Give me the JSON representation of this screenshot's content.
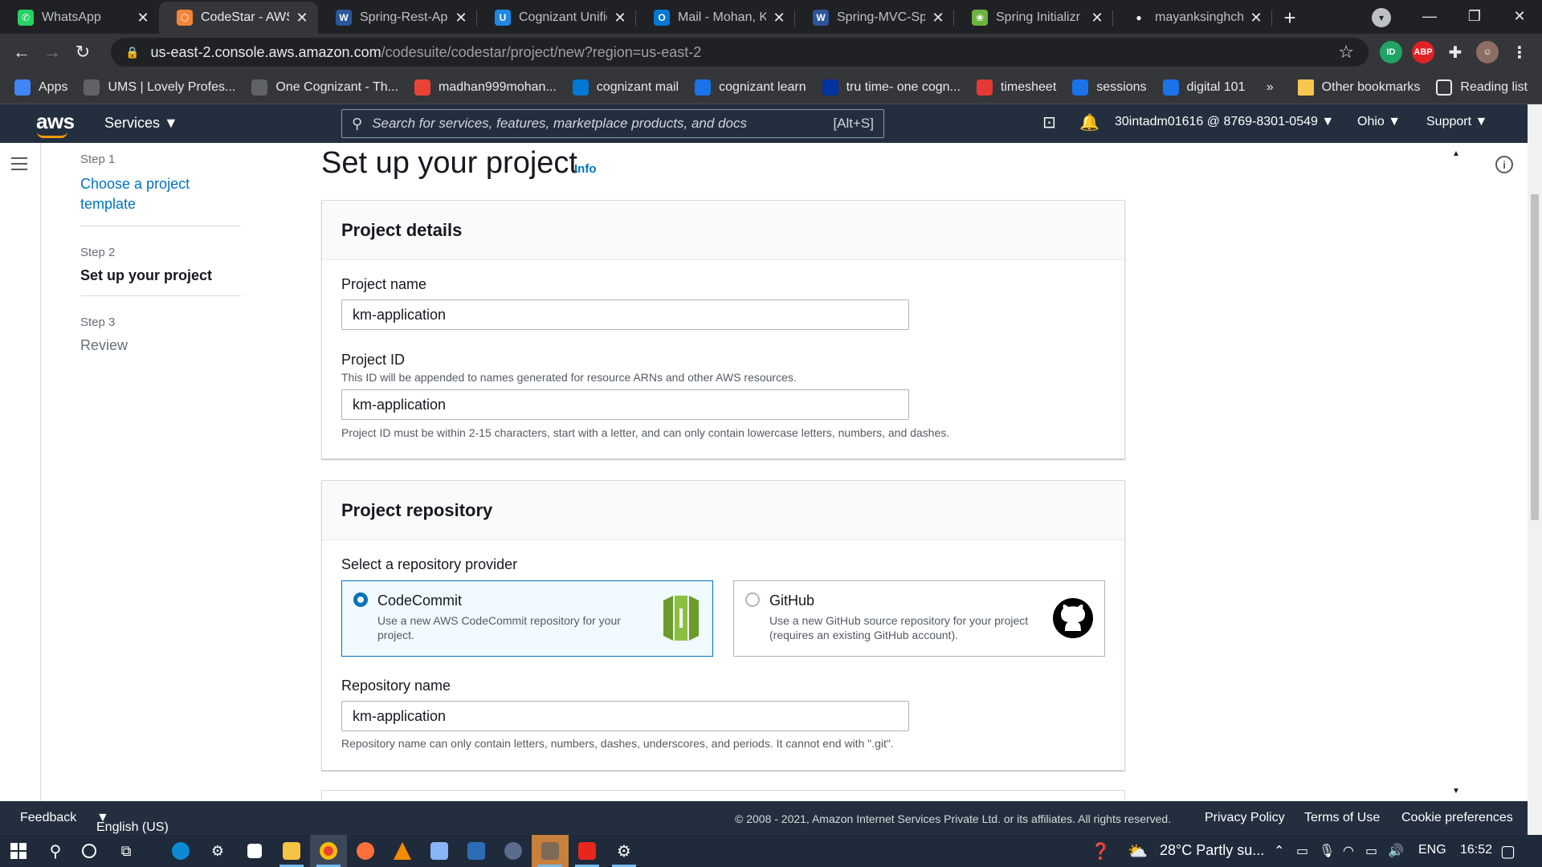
{
  "browser": {
    "tabs": [
      {
        "title": "WhatsApp",
        "color": "#25d366",
        "glyph": "✆"
      },
      {
        "title": "CodeStar - AWS D",
        "color": "#f58536",
        "glyph": "⬡"
      },
      {
        "title": "Spring-Rest-App",
        "color": "#2b579a",
        "glyph": "W"
      },
      {
        "title": "Cognizant Unified",
        "color": "#1e88e5",
        "glyph": "U"
      },
      {
        "title": "Mail - Mohan, Ko",
        "color": "#0078d4",
        "glyph": "O"
      },
      {
        "title": "Spring-MVC-Sprin",
        "color": "#2b579a",
        "glyph": "W"
      },
      {
        "title": "Spring Initializr",
        "color": "#6db33f",
        "glyph": "❀"
      },
      {
        "title": "mayanksinghchou",
        "color": "#202124",
        "glyph": "●"
      }
    ],
    "new_tab": "+",
    "url_host": "us-east-2.console.aws.amazon.com",
    "url_path": "/codesuite/codestar/project/new?region=us-east-2",
    "bookmarks": [
      {
        "label": "Apps",
        "color": "#4285f4"
      },
      {
        "label": "UMS | Lovely Profes...",
        "color": "#5f6368"
      },
      {
        "label": "One Cognizant - Th...",
        "color": "#5f6368"
      },
      {
        "label": "madhan999mohan...",
        "color": "#ea4335"
      },
      {
        "label": "cognizant mail",
        "color": "#0078d4"
      },
      {
        "label": "cognizant learn",
        "color": "#1a73e8"
      },
      {
        "label": "tru time- one cogn...",
        "color": "#0033a0"
      },
      {
        "label": "timesheet",
        "color": "#e53935"
      },
      {
        "label": "sessions",
        "color": "#1a73e8"
      },
      {
        "label": "digital 101",
        "color": "#1a73e8"
      }
    ],
    "more_bookmarks": "»",
    "other_bookmarks": "Other bookmarks",
    "reading_list": "Reading list"
  },
  "aws": {
    "logo": "aws",
    "services": "Services",
    "search_placeholder": "Search for services, features, marketplace products, and docs",
    "search_shortcut": "[Alt+S]",
    "account": "30intadm01616 @ 8769-8301-0549",
    "region": "Ohio",
    "support": "Support"
  },
  "steps": [
    {
      "step": "Step 1",
      "label": "Choose a project template"
    },
    {
      "step": "Step 2",
      "label": "Set up your project"
    },
    {
      "step": "Step 3",
      "label": "Review"
    }
  ],
  "page": {
    "title": "Set up your project",
    "info": "Info"
  },
  "project_details": {
    "heading": "Project details",
    "name_label": "Project name",
    "name_value": "km-application",
    "id_label": "Project ID",
    "id_desc": "This ID will be appended to names generated for resource ARNs and other AWS resources.",
    "id_value": "km-application",
    "id_hint": "Project ID must be within 2-15 characters, start with a letter, and can only contain lowercase letters, numbers, and dashes."
  },
  "project_repository": {
    "heading": "Project repository",
    "provider_label": "Select a repository provider",
    "providers": [
      {
        "title": "CodeCommit",
        "desc": "Use a new AWS CodeCommit repository for your project.",
        "selected": true
      },
      {
        "title": "GitHub",
        "desc": "Use a new GitHub source repository for your project (requires an existing GitHub account).",
        "selected": false
      }
    ],
    "repo_label": "Repository name",
    "repo_value": "km-application",
    "repo_hint": "Repository name can only contain letters, numbers, dashes, underscores, and periods. It cannot end with \".git\"."
  },
  "footer": {
    "feedback": "Feedback",
    "language": "English (US)",
    "copyright": "© 2008 - 2021, Amazon Internet Services Private Ltd. or its affiliates. All rights reserved.",
    "privacy": "Privacy Policy",
    "terms": "Terms of Use",
    "cookies": "Cookie preferences"
  },
  "taskbar": {
    "weather": "28°C  Partly su...",
    "lang": "ENG",
    "time": "16:52"
  },
  "colors": {
    "aws_nav": "#232f3e",
    "aws_orange": "#ff9900",
    "link_blue": "#0073bb",
    "codecommit_green": "#6b9c2a"
  }
}
